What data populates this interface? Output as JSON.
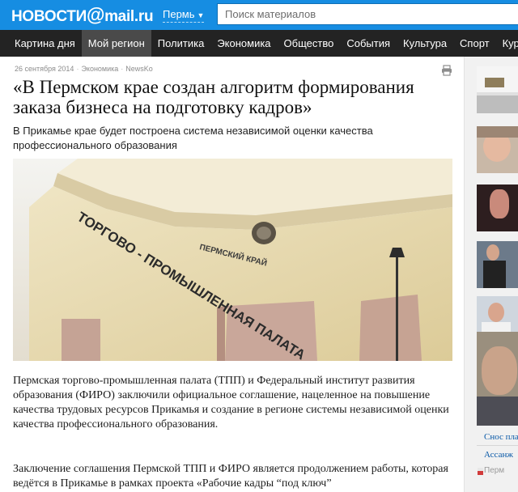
{
  "header": {
    "logo_left": "НОВОСТИ",
    "logo_at": "@",
    "logo_right": "mail.ru",
    "region": "Пермь",
    "search_placeholder": "Поиск материалов",
    "brand_color": "#168de2"
  },
  "nav": {
    "items": [
      {
        "label": "Картина дня",
        "active": false
      },
      {
        "label": "Мой регион",
        "active": true
      },
      {
        "label": "Политика",
        "active": false
      },
      {
        "label": "Экономика",
        "active": false
      },
      {
        "label": "Общество",
        "active": false
      },
      {
        "label": "События",
        "active": false
      },
      {
        "label": "Культура",
        "active": false
      },
      {
        "label": "Спорт",
        "active": false
      },
      {
        "label": "Курсы",
        "active": false
      }
    ]
  },
  "article": {
    "date": "26 сентября 2014",
    "rubric": "Экономика",
    "source": "NewsKo",
    "headline": "«В Пермском крае создан алгоритм формирования заказа бизнеса на подготовку кадров»",
    "lead": "В Прикамье крае будет построена система независимой оценки качества профессионального образования",
    "photo_sign_top": "ПЕРМСКИЙ КРАЙ",
    "photo_sign_main": "ТОРГОВО - ПРОМЫШЛЕННАЯ ПАЛАТА",
    "paragraph1": "Пермская торгово-промышленная палата (ТПП) и Федеральный институт развития образования (ФИРО) заключили официальное соглашение, нацеленное на повышение качества трудовых ресурсов Прикамья и создание в регионе системы независимой оценки качества профессионального образования.",
    "paragraph2": "Заключение соглашения Пермской ТПП и ФИРО является продолжением работы, которая ведётся в Прикамье в рамках проекта «Рабочие кадры “под ключ”"
  },
  "rail": {
    "link1": "Снос пла",
    "link2": "Ассанж",
    "source": "Перм"
  }
}
